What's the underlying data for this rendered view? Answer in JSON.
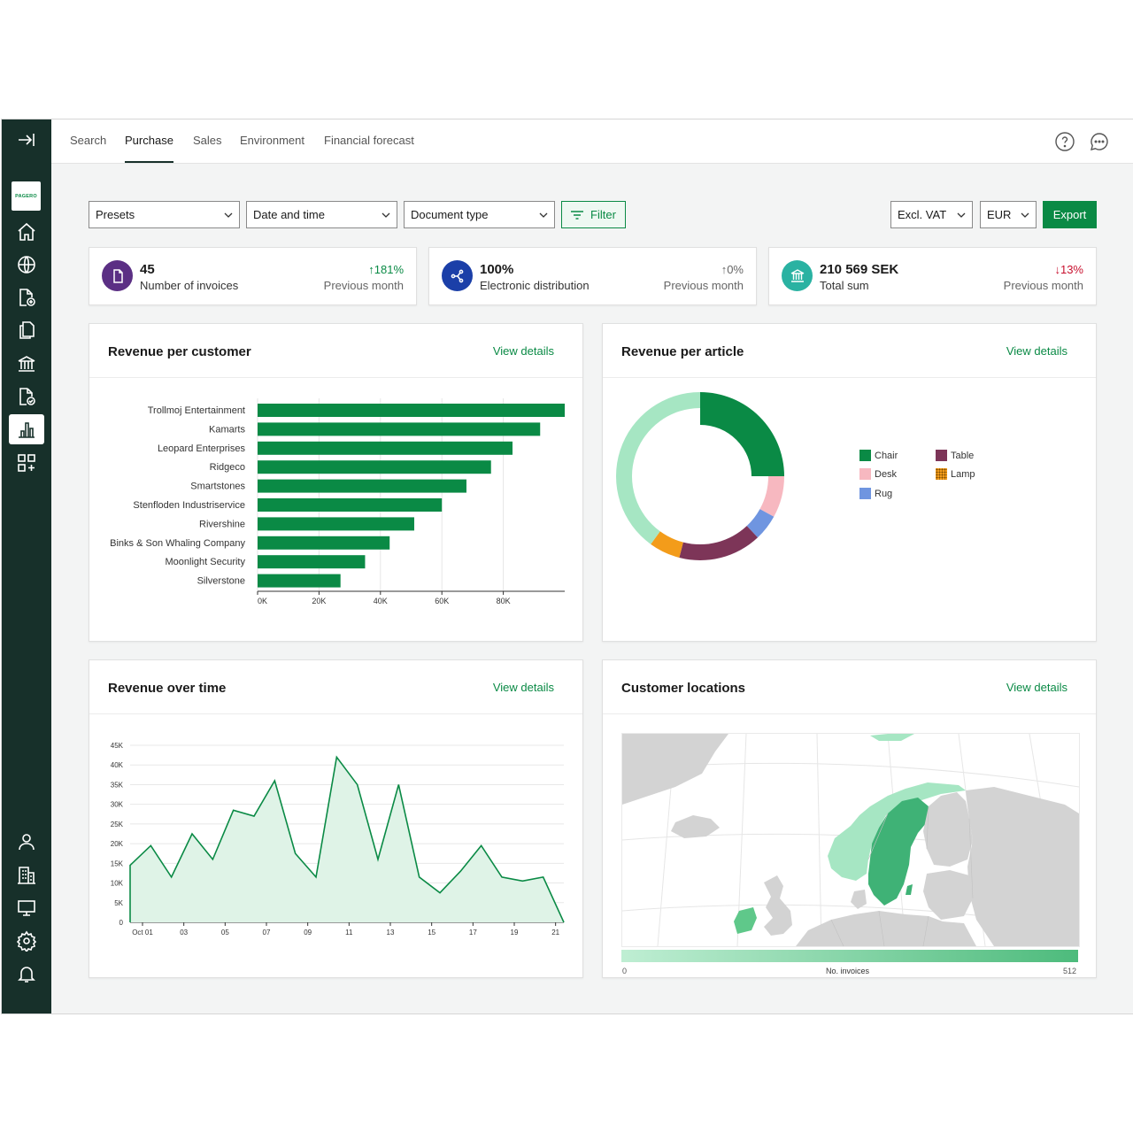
{
  "nav": {
    "tabs": [
      {
        "label": "Search"
      },
      {
        "label": "Purchase"
      },
      {
        "label": "Sales"
      },
      {
        "label": "Environment"
      },
      {
        "label": "Financial forecast"
      }
    ],
    "active_tab": "Purchase"
  },
  "sidebar": {
    "logo_text": "PAGERO",
    "icons": [
      "collapse-icon",
      "home-icon",
      "globe-icon",
      "add-document-icon",
      "documents-icon",
      "bank-icon",
      "document-check-icon",
      "bar-chart-icon",
      "add-widget-icon",
      "user-icon",
      "building-icon",
      "monitor-icon",
      "settings-icon",
      "bell-icon"
    ],
    "active_icon": "bar-chart-icon"
  },
  "toolbar": {
    "presets": "Presets",
    "date_time": "Date and time",
    "document_type": "Document type",
    "filter_label": "Filter",
    "vat": "Excl. VAT",
    "currency": "EUR",
    "export_label": "Export"
  },
  "kpis": [
    {
      "value": "45",
      "label": "Number of invoices",
      "change": "181%",
      "direction": "up",
      "prev": "Previous month",
      "color": "#5b2f84"
    },
    {
      "value": "100%",
      "label": "Electronic distribution",
      "change": "0%",
      "direction": "up",
      "prev": "Previous month",
      "color": "#1b3fa8"
    },
    {
      "value": "210 569 SEK",
      "label": "Total sum",
      "change": "13%",
      "direction": "down",
      "prev": "Previous month",
      "color": "#2ab2a2"
    }
  ],
  "panels": {
    "customer": {
      "title": "Revenue per customer",
      "link": "View details"
    },
    "article": {
      "title": "Revenue per article",
      "link": "View details"
    },
    "time": {
      "title": "Revenue over time",
      "link": "View details"
    },
    "locations": {
      "title": "Customer locations",
      "link": "View details"
    }
  },
  "colors": {
    "accent": "#0a8a45",
    "sidebar": "#17302a",
    "up": "#0a8a45",
    "down": "#c8102e"
  },
  "chart_data": [
    {
      "type": "bar",
      "orientation": "horizontal",
      "categories": [
        "Trollmoj Entertainment",
        "Kamarts",
        "Leopard Enterprises",
        "Ridgeco",
        "Smartstones",
        "Stenfloden Industriservice",
        "Rivershine",
        "Binks & Son Whaling Company",
        "Moonlight Security",
        "Silverstone"
      ],
      "values": [
        100000,
        92000,
        83000,
        76000,
        68000,
        60000,
        51000,
        43000,
        35000,
        27000
      ],
      "ticks": [
        "0K",
        "20K",
        "40K",
        "60K",
        "80K"
      ],
      "xlim": [
        0,
        100000
      ],
      "color": "#0a8a45",
      "grid": true
    },
    {
      "type": "pie",
      "donut": true,
      "slices": [
        {
          "name": "Chair",
          "value": 25,
          "color": "#0a8a45"
        },
        {
          "name": "Desk",
          "value": 8,
          "color": "#f7b8c0"
        },
        {
          "name": "Rug",
          "value": 5,
          "color": "#6f95e0"
        },
        {
          "name": "Table",
          "value": 16,
          "color": "#7d3558"
        },
        {
          "name": "Lamp",
          "value": 6,
          "color": "#f39c1a"
        },
        {
          "name": "",
          "value": 40,
          "color": "#a6e6c3"
        }
      ],
      "legend": [
        "Chair",
        "Table",
        "Desk",
        "Lamp",
        "Rug"
      ],
      "legend_position": "right"
    },
    {
      "type": "area",
      "x": [
        "Oct 01",
        "02",
        "03",
        "04",
        "05",
        "06",
        "07",
        "08",
        "09",
        "10",
        "11",
        "12",
        "13",
        "14",
        "15",
        "16",
        "17",
        "18",
        "19",
        "20",
        "21"
      ],
      "x_ticks": [
        "Oct 01",
        "03",
        "05",
        "07",
        "09",
        "11",
        "13",
        "15",
        "17",
        "19",
        "21"
      ],
      "values": [
        14500,
        19500,
        11500,
        22500,
        16000,
        28500,
        27000,
        36000,
        17500,
        11500,
        42000,
        35000,
        16000,
        35000,
        11500,
        7500,
        13000,
        19500,
        11500,
        10500,
        11500,
        0
      ],
      "y_ticks": [
        "0",
        "5K",
        "10K",
        "15K",
        "20K",
        "25K",
        "30K",
        "35K",
        "40K",
        "45K"
      ],
      "ylim": [
        0,
        45000
      ],
      "color": "#0a8a45",
      "grid": true
    },
    {
      "type": "heatmap",
      "kind": "choropleth-map",
      "scale_label": "No. invoices",
      "scale_min": "0",
      "scale_max": "512"
    }
  ]
}
